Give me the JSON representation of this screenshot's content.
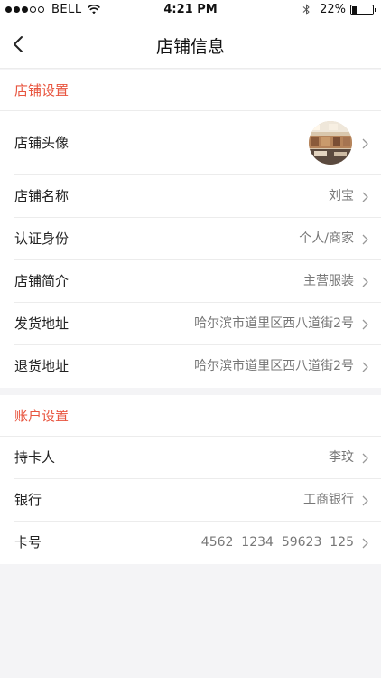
{
  "status_bar": {
    "carrier": "BELL",
    "time": "4:21 PM",
    "battery": "22%"
  },
  "nav": {
    "title": "店铺信息",
    "back_icon": "chevron-left-icon"
  },
  "colors": {
    "accent": "#e8553f",
    "background": "#f4f4f6"
  },
  "shop_settings": {
    "header": "店铺设置",
    "avatar_label": "店铺头像",
    "rows": [
      {
        "label": "店铺名称",
        "value": "刘宝"
      },
      {
        "label": "认证身份",
        "value": "个人/商家"
      },
      {
        "label": "店铺简介",
        "value": "主营服装"
      },
      {
        "label": "发货地址",
        "value": "哈尔滨市道里区西八道街2号"
      },
      {
        "label": "退货地址",
        "value": "哈尔滨市道里区西八道街2号"
      }
    ]
  },
  "account_settings": {
    "header": "账户设置",
    "rows": [
      {
        "label": "持卡人",
        "value": "李玟"
      },
      {
        "label": "银行",
        "value": "工商银行"
      },
      {
        "label": "卡号",
        "value": "4562  1234  59623  125"
      }
    ]
  }
}
